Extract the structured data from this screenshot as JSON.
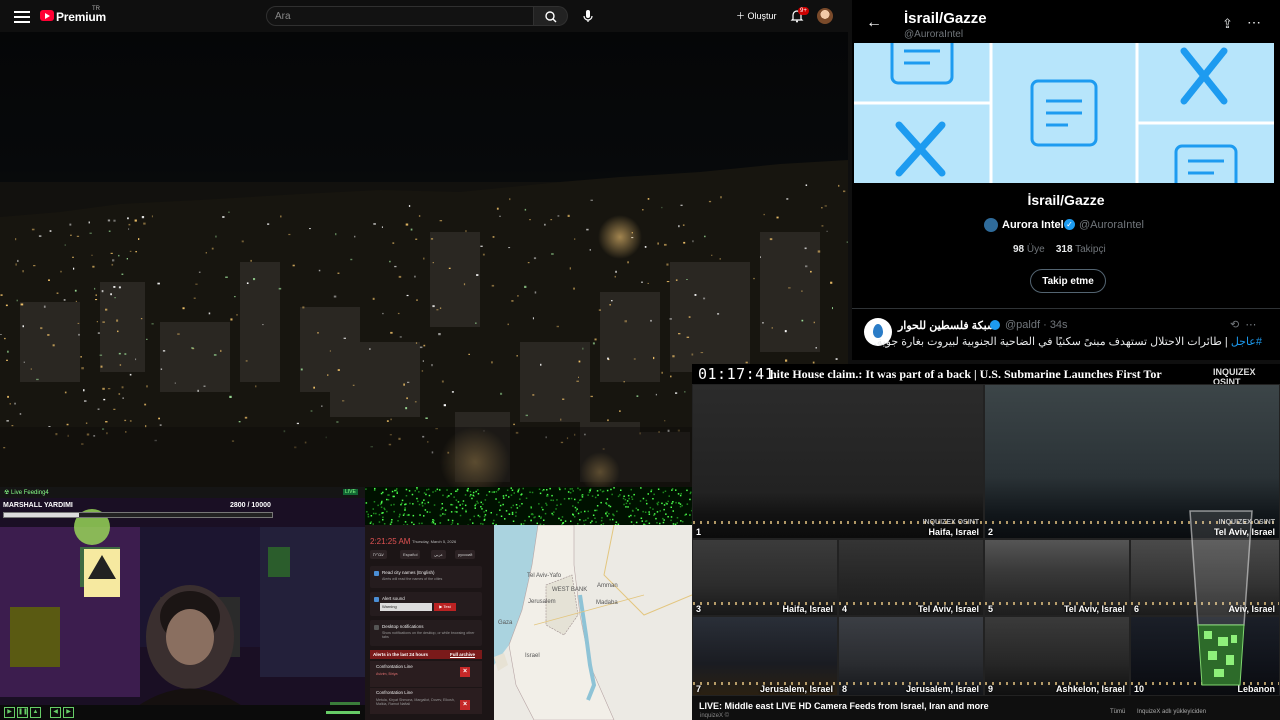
{
  "youtube": {
    "brand": "Premium",
    "region": "TR",
    "search_placeholder": "Ara",
    "create_label": "Oluştur",
    "notification_count": "9+"
  },
  "twitter": {
    "header_title": "İsrail/Gazze",
    "header_handle": "@AuroraIntel",
    "list_title": "İsrail/Gazze",
    "owner_name": "Aurora Intel",
    "owner_handle": "@AuroraIntel",
    "members_count": "98",
    "members_label": "Üye",
    "followers_count": "318",
    "followers_label": "Takipçi",
    "follow_button": "Takip etme",
    "post": {
      "author": "شبكة فلسطين للحوار",
      "handle": "@paldf",
      "time": "34s",
      "hashtag": "#عاجل",
      "text": " | طائرات الاحتلال تستهدف مبنىً سكنيًا في الضاحية الجنوبية لبيروت بغارة جوية."
    }
  },
  "ticker": {
    "time": "01:17:41",
    "text": "hite House claim.: It was part of a back     |     U.S. Submarine Launches First Tor",
    "logo": "INQUIZEX OSINT"
  },
  "cameras": [
    {
      "num": "1",
      "city": "Haifa, Israel",
      "wm": "INQUIZEX OSINT"
    },
    {
      "num": "2",
      "city": "Tel Aviv, Israel",
      "wm": "INQUIZEX OSINT"
    },
    {
      "num": "3",
      "city": "Haifa, Israel"
    },
    {
      "num": "4",
      "city": "Tel Aviv, Israel"
    },
    {
      "num": "5",
      "city": "Tel Aviv, Israel"
    },
    {
      "num": "6",
      "city": "Aviv, Israel"
    },
    {
      "num": "7",
      "city": "Jerusalem, Israel"
    },
    {
      "num": "8",
      "city": "Jerusalem, Israel"
    },
    {
      "num": "9",
      "city": "Ashkelon, Israel"
    },
    {
      "num": "10",
      "city": "Lebanon"
    }
  ],
  "camera_caption": "LIVE: Middle east LIVE HD Camera Feeds from Israel, Iran and more",
  "camera_sub": "InquizeX adlı yükleyiciden",
  "camera_sub_left": "inquizeX ©",
  "camera_sub_tab1": "Tümü",
  "camera_sub_tab2": "InquizeX adlı yükleyiciden",
  "stream": {
    "title": "☢ Live Feeding4",
    "badge": "LIVE",
    "mission": "MARSHALL YARDIMI",
    "score": "2800  / 10000",
    "progress": 0.28,
    "sign_text": "DİKKAT"
  },
  "alerts_ext": {
    "time": "2:21:25 AM",
    "date": "Thursday, March 5, 2026",
    "languages": [
      "עברית",
      "Español",
      "عربي",
      "русский"
    ],
    "read_names_label": "Read city names (English)",
    "read_names_sub": "Alerts will read the names of the cities",
    "alert_sound_label": "Alert sound",
    "alert_sound_value": "Warning",
    "test_button": "▶ Test",
    "desktop_label": "Desktop notifications",
    "desktop_sub": "Show notifications on the desktop, or while browsing other tabs",
    "alerts_title": "Alerts in the last 24 hours",
    "full_archive": "Full archive",
    "alerts": [
      {
        "title": "Confrontation Line",
        "sub": "Avivim, Biriya"
      },
      {
        "title": "Confrontation Line",
        "sub": "Metula, Kiryat Shmona, Margaliot, Dovev, Elkosh, Malkia, Ramot Naftali"
      }
    ]
  },
  "map": {
    "labels": [
      "Tel Aviv-Yafo",
      "WEST BANK",
      "Amman",
      "Jerusalem",
      "Gaza",
      "Israel",
      "Madaba"
    ]
  }
}
